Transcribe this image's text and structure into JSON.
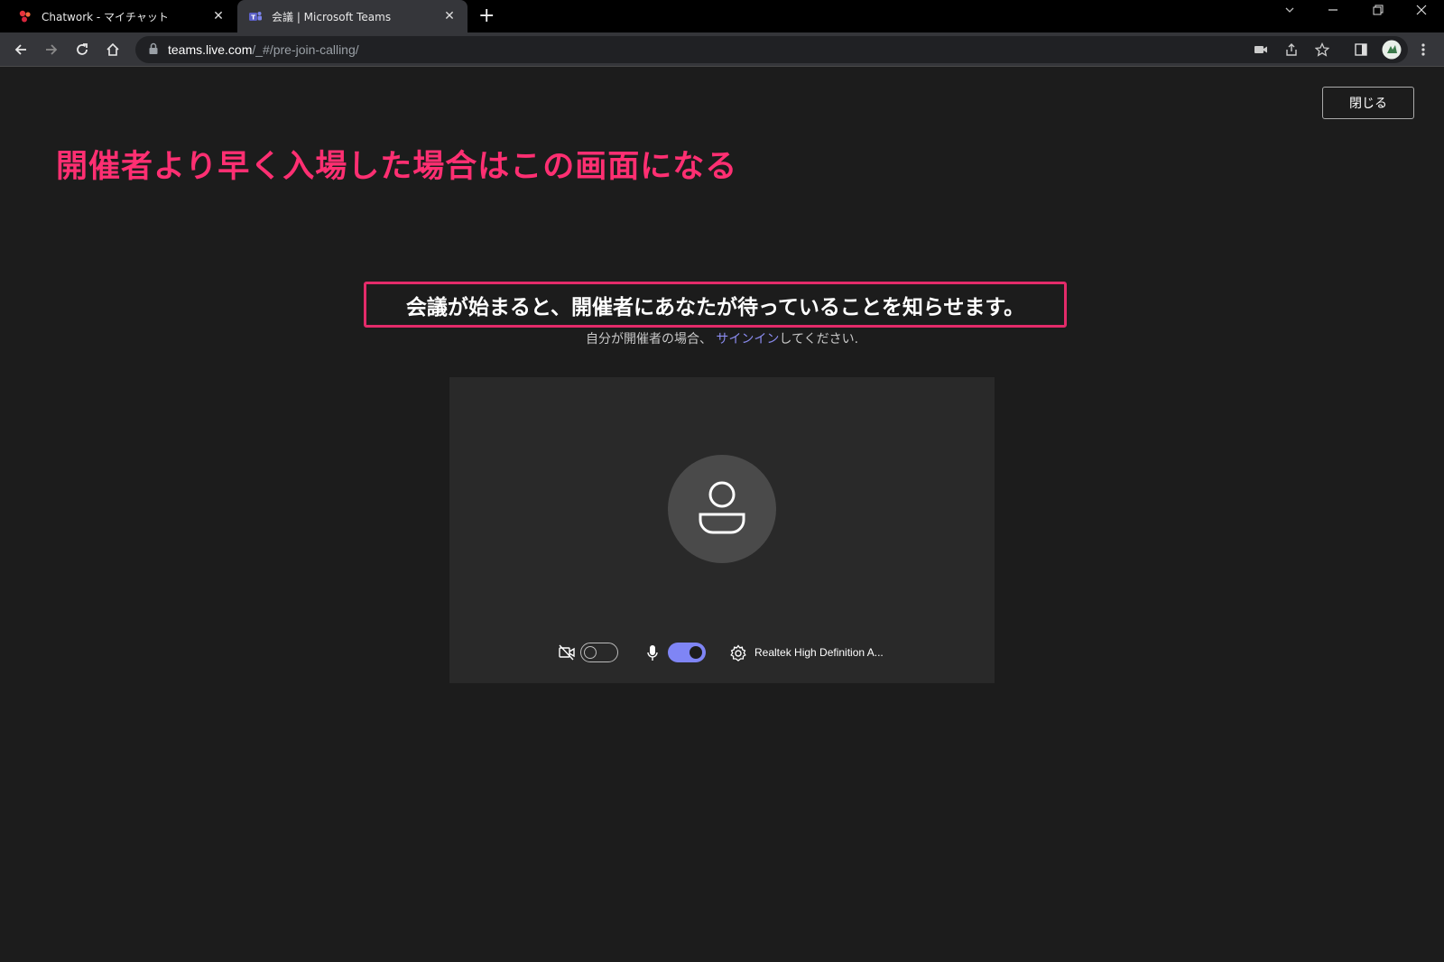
{
  "browser": {
    "tabs": [
      {
        "title": "Chatwork - マイチャット",
        "active": false
      },
      {
        "title": "会議 | Microsoft Teams",
        "active": true
      }
    ],
    "url_host": "teams.live.com",
    "url_path": "/_#/pre-join-calling/"
  },
  "page": {
    "close_label": "閉じる",
    "annotation": "開催者より早く入場した場合はこの画面になる",
    "headline": "会議が始まると、開催者にあなたが待っていることを知らせます。",
    "sub_prefix": "自分が開催者の場合、",
    "sub_link": "サインイン",
    "sub_suffix": "してください.",
    "camera_on": false,
    "mic_on": true,
    "audio_device": "Realtek High Definition A..."
  },
  "colors": {
    "annotation": "#ff2f72",
    "highlight_border": "#e32b6a",
    "accent": "#7f85f5"
  }
}
